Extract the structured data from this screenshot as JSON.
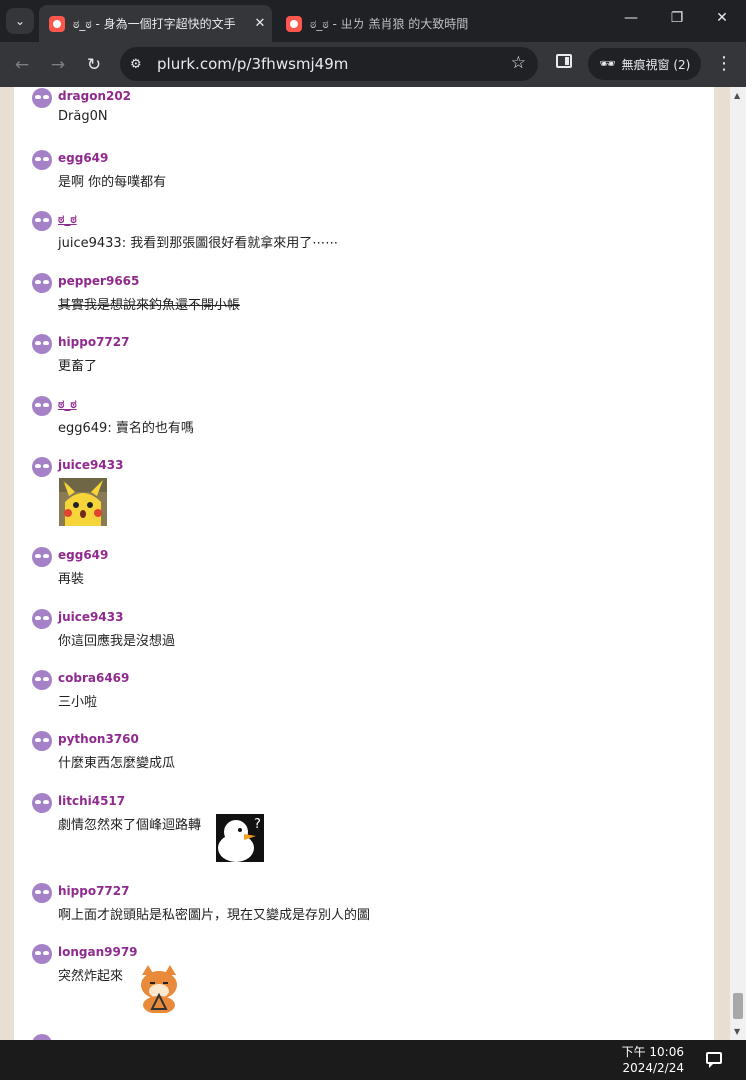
{
  "browser": {
    "tabs": [
      {
        "title": "ಠ_ಠ - 身為一個打字超快的文手",
        "active": true
      },
      {
        "title": "ಠ_ಠ - ㄓㄌ 羔肖狼 的大致時間",
        "active": false
      }
    ],
    "url": "plurk.com/p/3fhwsmj49m",
    "incognito_label": "無痕視窗 (2)",
    "icons": {
      "tab_menu": "chevron-down-icon",
      "favicon": "plurk-icon",
      "back": "back-arrow-icon",
      "forward": "forward-arrow-icon",
      "reload": "reload-icon",
      "site_info": "tune-icon",
      "bookmark": "star-icon",
      "side_panel": "side-panel-icon",
      "incognito": "incognito-icon",
      "menu": "kebab-menu-icon"
    }
  },
  "responses": [
    {
      "user": "dragon202",
      "text": "Drăg0N"
    },
    {
      "user": "egg649",
      "text": "是啊 你的每噗都有"
    },
    {
      "user": "ಠ_ಠ",
      "text": "juice9433: 我看到那張圖很好看就拿來用了⋯⋯"
    },
    {
      "user": "pepper9665",
      "text": "其實我是想說來釣魚還不開小帳"
    },
    {
      "user": "hippo7727",
      "text": "更畜了"
    },
    {
      "user": "ಠ_ಠ",
      "text": "egg649: 賣名的也有嗎"
    },
    {
      "user": "juice9433",
      "text": "",
      "emoticon": "surprised-pikachu"
    },
    {
      "user": "egg649",
      "text": "再裝"
    },
    {
      "user": "juice9433",
      "text": "你這回應我是沒想過"
    },
    {
      "user": "cobra6469",
      "text": "三小啦"
    },
    {
      "user": "python3760",
      "text": "什麼東西怎麼變成瓜"
    },
    {
      "user": "litchi4517",
      "text": "劇情忽然來了個峰迴路轉",
      "emoticon": "confused-duck"
    },
    {
      "user": "hippo7727",
      "text": "啊上面才說頭貼是私密圖片，現在又變成是存別人的圖"
    },
    {
      "user": "longan9979",
      "text": "突然炸起來",
      "emoticon": "fox-triangle"
    }
  ],
  "taskbar": {
    "time": "下午 10:06",
    "date": "2024/2/24",
    "notification_icon": "chat-notification-icon"
  },
  "colors": {
    "username": "#8f2a8e",
    "avatar": "#a582c8",
    "page_bg": "#e8dfd3"
  }
}
